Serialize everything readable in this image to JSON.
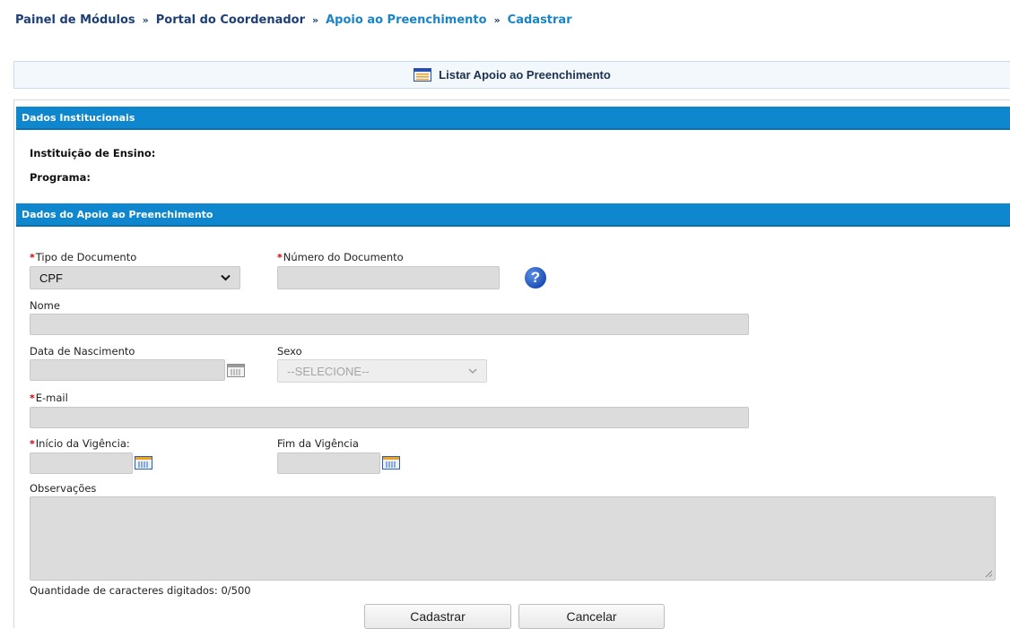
{
  "breadcrumb": {
    "items": [
      {
        "label": "Painel de Módulos"
      },
      {
        "label": "Portal do Coordenador"
      },
      {
        "label": "Apoio ao Preenchimento"
      },
      {
        "label": "Cadastrar"
      }
    ],
    "separator": "»"
  },
  "list_link": {
    "label": "Listar Apoio ao Preenchimento",
    "icon": "list-icon"
  },
  "sections": {
    "institutional": {
      "title": "Dados Institucionais"
    },
    "support": {
      "title": "Dados do Apoio ao Preenchimento"
    }
  },
  "institutional": {
    "institution_label": "Instituição de Ensino:",
    "program_label": "Programa:"
  },
  "form": {
    "required_marker": "*",
    "doc_type": {
      "label": "Tipo de Documento",
      "value": "CPF"
    },
    "doc_number": {
      "label": "Número do Documento",
      "value": ""
    },
    "help_icon": "?",
    "name": {
      "label": "Nome",
      "value": ""
    },
    "birth_date": {
      "label": "Data de Nascimento",
      "value": ""
    },
    "sex": {
      "label": "Sexo",
      "value": "--SELECIONE--"
    },
    "email": {
      "label": "E-mail",
      "value": ""
    },
    "start_date": {
      "label": "Início da Vigência:",
      "value": ""
    },
    "end_date": {
      "label": "Fim da Vigência",
      "value": ""
    },
    "notes": {
      "label": "Observações",
      "value": ""
    },
    "char_counter": "Quantidade de caracteres digitados: 0/500"
  },
  "buttons": {
    "submit": "Cadastrar",
    "cancel": "Cancelar"
  },
  "colors": {
    "section_bar": "#0e87cf",
    "breadcrumb": "#1d3f73",
    "breadcrumb_active": "#1a84c7",
    "required": "#d40000",
    "input_bg": "#dcdcdc"
  }
}
